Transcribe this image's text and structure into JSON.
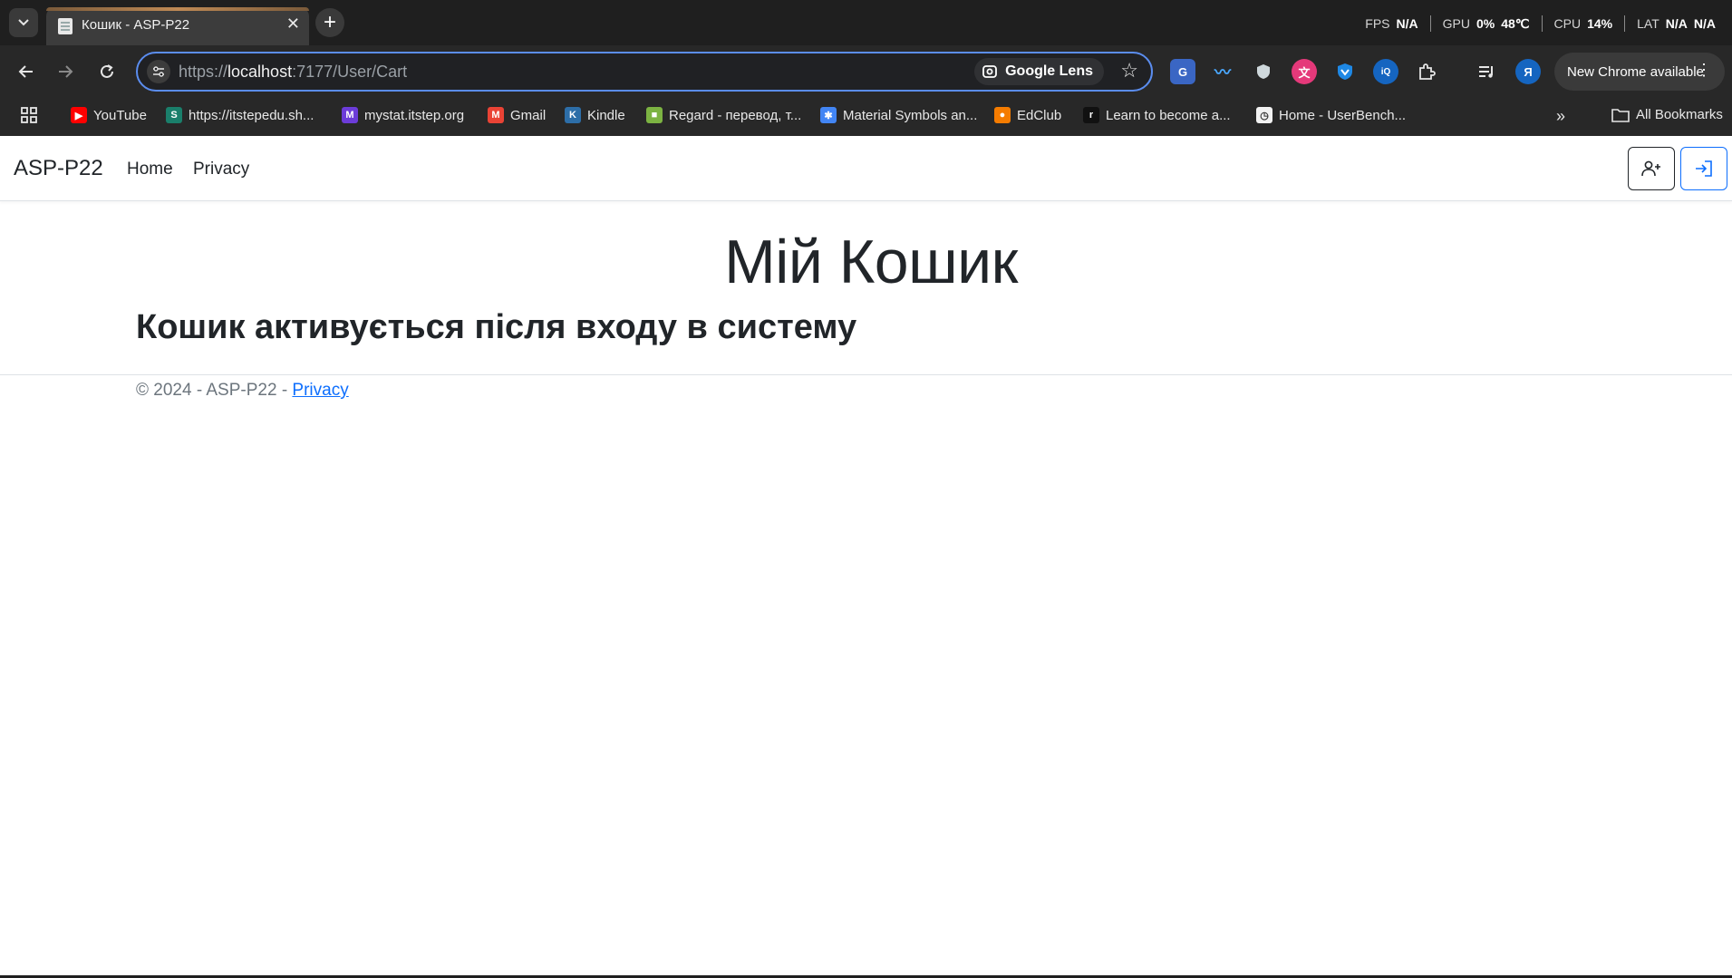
{
  "browser": {
    "tab": {
      "title": "Кошик - ASP-P22"
    },
    "perf": {
      "fps_label": "FPS",
      "fps_value": "N/A",
      "gpu_label": "GPU",
      "gpu_value": "0%",
      "gpu_temp": "48℃",
      "cpu_label": "CPU",
      "cpu_value": "14%",
      "lat_label": "LAT",
      "lat_value": "N/A",
      "extra_value": "N/A"
    },
    "address": {
      "scheme": "https://",
      "host": "localhost",
      "rest": ":7177/User/Cart"
    },
    "lens_label": "Google Lens",
    "update_label": "New Chrome available",
    "profile_initial": "Я",
    "bookmarks": [
      {
        "label": "YouTube",
        "color": "#ff0000",
        "glyph": "▶"
      },
      {
        "label": "https://itstepedu.sh...",
        "color": "#1a7f6b",
        "glyph": "S"
      },
      {
        "label": "mystat.itstep.org",
        "color": "#6c3cd9",
        "glyph": "M"
      },
      {
        "label": "Gmail",
        "color": "#ea4335",
        "glyph": "M"
      },
      {
        "label": "Kindle",
        "color": "#2d6ea8",
        "glyph": "K"
      },
      {
        "label": "Regard - перевод, т...",
        "color": "#7cb342",
        "glyph": "■"
      },
      {
        "label": "Material Symbols an...",
        "color": "#4285f4",
        "glyph": "✱"
      },
      {
        "label": "EdClub",
        "color": "#f57c00",
        "glyph": "●"
      },
      {
        "label": "Learn to become a...",
        "color": "#111111",
        "glyph": "r"
      },
      {
        "label": "Home - UserBench...",
        "color": "#f2f2f2",
        "glyph": "◷"
      }
    ],
    "all_bookmarks_label": "All Bookmarks"
  },
  "site": {
    "brand": "ASP-P22",
    "nav": {
      "home": "Home",
      "privacy": "Privacy"
    },
    "title": "Мій Кошик",
    "subtitle": "Кошик активується після входу в систему",
    "footer": {
      "text": "© 2024 - ASP-P22 - ",
      "link": "Privacy"
    }
  }
}
